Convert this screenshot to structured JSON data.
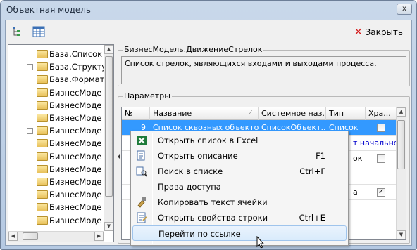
{
  "window": {
    "title": "Объектная модель",
    "close_glyph": "x"
  },
  "toolbar": {
    "close_label": "Закрыть",
    "close_glyph": "✕"
  },
  "tree": {
    "items": [
      {
        "label": "База.Список",
        "expandable": false
      },
      {
        "label": "База.Структу",
        "expandable": true
      },
      {
        "label": "База.Формат",
        "expandable": false
      },
      {
        "label": "БизнесМоде",
        "expandable": false
      },
      {
        "label": "БизнесМоде",
        "expandable": false
      },
      {
        "label": "БизнесМоде",
        "expandable": false
      },
      {
        "label": "БизнесМоде",
        "expandable": true
      },
      {
        "label": "БизнесМоде",
        "expandable": false
      },
      {
        "label": "БизнесМоде",
        "expandable": false
      },
      {
        "label": "БизнесМоде",
        "expandable": false
      },
      {
        "label": "БизнесМоде",
        "expandable": false
      },
      {
        "label": "БизнесМоде",
        "expandable": false
      },
      {
        "label": "БизнесМоде",
        "expandable": false
      },
      {
        "label": "БизнесМоде",
        "expandable": false
      }
    ]
  },
  "object": {
    "group_title": "БизнесМодель.ДвижениеСтрелок",
    "description": "Список стрелок, являющихся входами и выходами процесса."
  },
  "params": {
    "group_title": "Параметры",
    "columns": [
      "№",
      "Название",
      "Системное наз...",
      "Тип",
      "Хра..."
    ],
    "selected_row": {
      "num": "9",
      "name": "Список сквозных объектов",
      "sysname": "СписокОбъект...",
      "type": "Список",
      "stored": false
    },
    "partial_texts": {
      "row2_link": "т начальной",
      "row3_type": "ок",
      "row5_type": "а"
    }
  },
  "context_menu": {
    "items": [
      {
        "label": "Открыть список в Excel",
        "shortcut": "",
        "icon": "excel-icon"
      },
      {
        "label": "Открыть описание",
        "shortcut": "F1",
        "icon": "description-icon"
      },
      {
        "label": "Поиск в списке",
        "shortcut": "Ctrl+F",
        "icon": "search-list-icon"
      },
      {
        "label": "Права доступа",
        "shortcut": "",
        "icon": ""
      },
      {
        "label": "Копировать текст ячейки",
        "shortcut": "",
        "icon": "copy-brush-icon"
      },
      {
        "label": "Открыть свойства строки",
        "shortcut": "Ctrl+E",
        "icon": "properties-icon"
      },
      {
        "label": "Перейти по ссылке",
        "shortcut": "",
        "icon": "",
        "highlighted": true
      }
    ]
  },
  "colors": {
    "selection": "#3399ff",
    "link": "#0000cc",
    "close_red": "#d41a1a"
  }
}
